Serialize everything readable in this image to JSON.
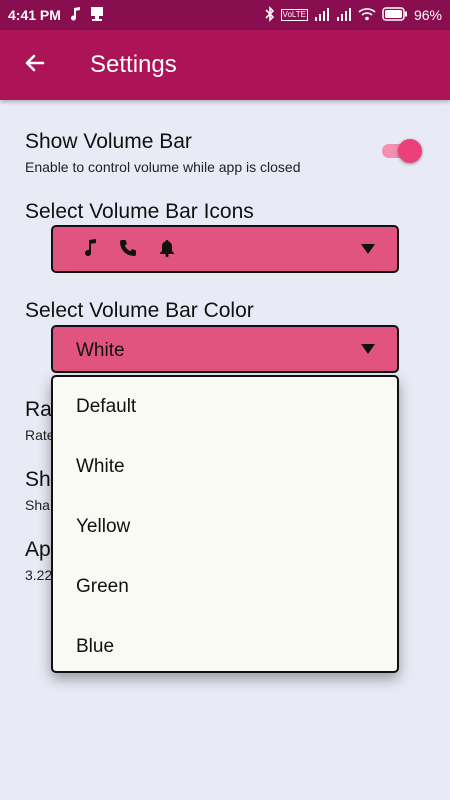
{
  "status_bar": {
    "time": "4:41 PM",
    "battery": "96%",
    "network_badge": "VoLTE"
  },
  "app_bar": {
    "title": "Settings"
  },
  "settings": {
    "volume_bar": {
      "title": "Show Volume Bar",
      "subtitle": "Enable to control volume while app is closed",
      "enabled": true
    },
    "icons": {
      "title": "Select Volume Bar Icons",
      "selected_icons": [
        "music-note-icon",
        "phone-icon",
        "bell-icon"
      ]
    },
    "color": {
      "title": "Select Volume Bar Color",
      "selected": "White",
      "options": [
        "Default",
        "White",
        "Yellow",
        "Green",
        "Blue"
      ]
    },
    "obscured": [
      {
        "title": "Ra",
        "subtitle": "Rate"
      },
      {
        "title": "Sh",
        "subtitle": "Sha"
      },
      {
        "title": "Ap",
        "subtitle": "3.22"
      }
    ]
  },
  "colors": {
    "status_bar": "#880e4f",
    "app_bar": "#ad1457",
    "accent": "#e1547f",
    "background": "#e8eaf5"
  }
}
